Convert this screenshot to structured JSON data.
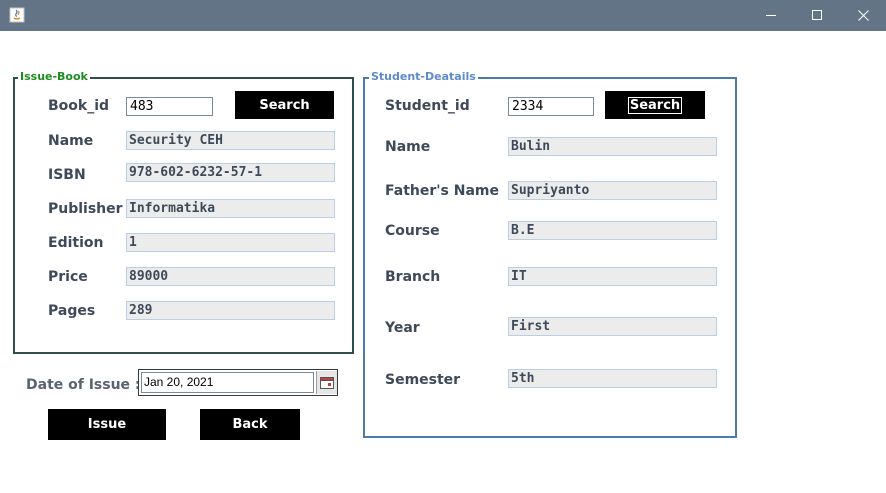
{
  "window": {
    "icon": "java-icon",
    "controls": [
      "minimize-icon",
      "maximize-icon",
      "close-icon"
    ],
    "titlebar_color": "#647487"
  },
  "issue_book": {
    "title": "Issue-Book",
    "book_id_label": "Book_id",
    "book_id_value": "483",
    "search_label": "Search",
    "name_label": "Name",
    "name_value": "Security CEH",
    "isbn_label": "ISBN",
    "isbn_value": "978-602-6232-57-1",
    "publisher_label": "Publisher",
    "publisher_value": "Informatika",
    "edition_label": "Edition",
    "edition_value": "1",
    "price_label": "Price",
    "price_value": "89000",
    "pages_label": "Pages",
    "pages_value": "289"
  },
  "student_details": {
    "title": "Student-Deatails",
    "student_id_label": "Student_id",
    "student_id_value": "2334",
    "search_label": "Search",
    "name_label": "Name",
    "name_value": "Bulin",
    "father_label": "Father's Name",
    "father_value": "Supriyanto",
    "course_label": "Course",
    "course_value": "B.E",
    "branch_label": "Branch",
    "branch_value": "IT",
    "year_label": "Year",
    "year_value": "First",
    "semester_label": "Semester",
    "semester_value": "5th"
  },
  "date": {
    "label": "Date of Issue :",
    "value": "Jan 20, 2021",
    "picker_icon": "calendar-icon"
  },
  "actions": {
    "issue_label": "Issue",
    "back_label": "Back"
  }
}
